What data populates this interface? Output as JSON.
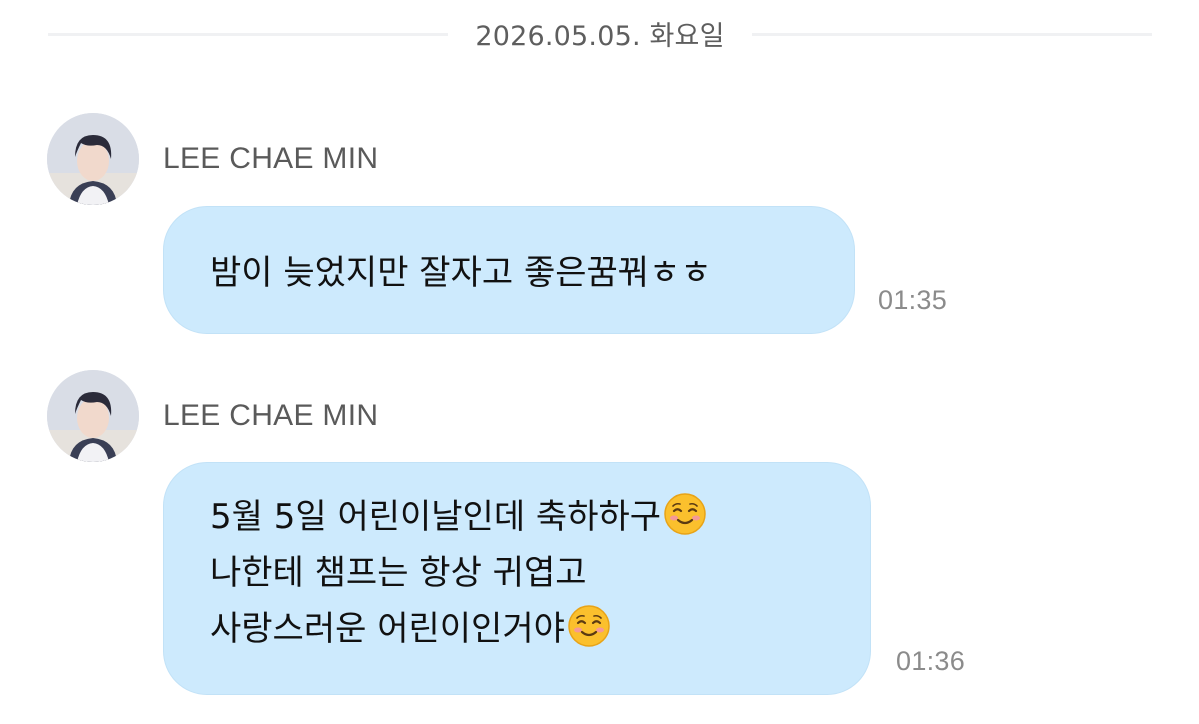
{
  "date_divider": {
    "text": "2026.05.05. 화요일"
  },
  "messages": [
    {
      "sender": "LEE CHAE MIN",
      "lines": [
        "밤이 늦었지만 잘자고 좋은꿈꿔ㅎㅎ"
      ],
      "time": "01:35"
    },
    {
      "sender": "LEE CHAE MIN",
      "lines": [
        "5월 5일 어린이날인데 축하하구",
        "나한테 챔프는 항상 귀엽고",
        "사랑스러운 어린이인거야"
      ],
      "time": "01:36"
    }
  ],
  "colors": {
    "bubble": "#cdeafd",
    "text": "#111111",
    "time": "#8b8b8b",
    "sender": "#5a5a5a"
  },
  "icons": {
    "avatar": "profile-photo",
    "emoji": "smiling-face-emoji"
  }
}
